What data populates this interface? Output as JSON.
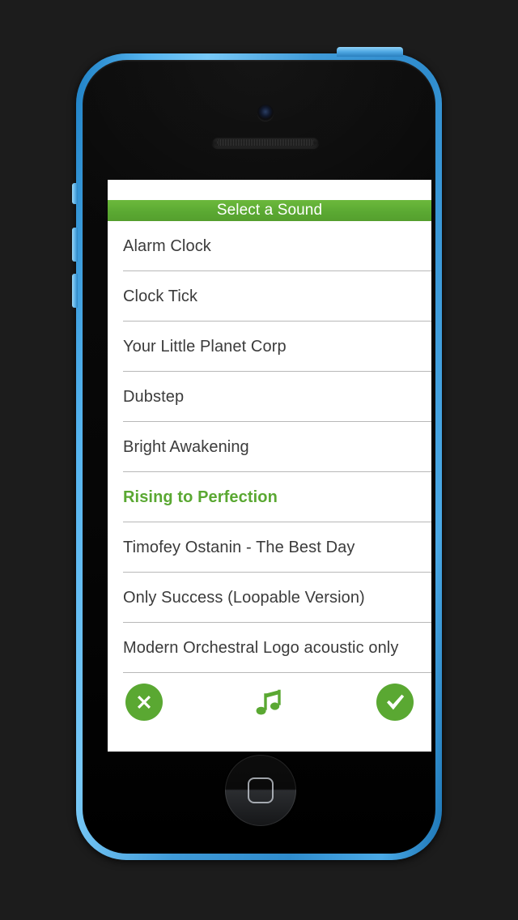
{
  "device": {
    "model_color": "#3f9ad8",
    "buttons": {
      "power": "power-button",
      "ringer_switch": "ringer-switch",
      "volume_up": "volume-up-button",
      "volume_down": "volume-down-button",
      "home": "home-button"
    },
    "camera": "front-camera",
    "earpiece": "earpiece-speaker"
  },
  "app": {
    "title": "Select a Sound",
    "accent_color": "#5aa832",
    "title_text_color": "#ffffff",
    "background_color": "#ffffff",
    "separator_color": "#b8b8b8",
    "item_text_color": "#3b3b3b"
  },
  "sounds": [
    {
      "label": "Alarm Clock",
      "selected": false
    },
    {
      "label": "Clock Tick",
      "selected": false
    },
    {
      "label": "Your Little Planet Corp",
      "selected": false
    },
    {
      "label": "Dubstep",
      "selected": false
    },
    {
      "label": "Bright Awakening",
      "selected": false
    },
    {
      "label": "Rising to Perfection",
      "selected": true
    },
    {
      "label": "Timofey Ostanin - The Best Day",
      "selected": false
    },
    {
      "label": "Only Success (Loopable Version)",
      "selected": false
    },
    {
      "label": "Modern Orchestral Logo acoustic only",
      "selected": false
    }
  ],
  "toolbar": {
    "cancel": {
      "icon": "close-x-icon",
      "color": "#5aa832"
    },
    "preview": {
      "icon": "music-note-icon",
      "color": "#5aa832"
    },
    "confirm": {
      "icon": "check-mark-icon",
      "color": "#5aa832"
    }
  }
}
